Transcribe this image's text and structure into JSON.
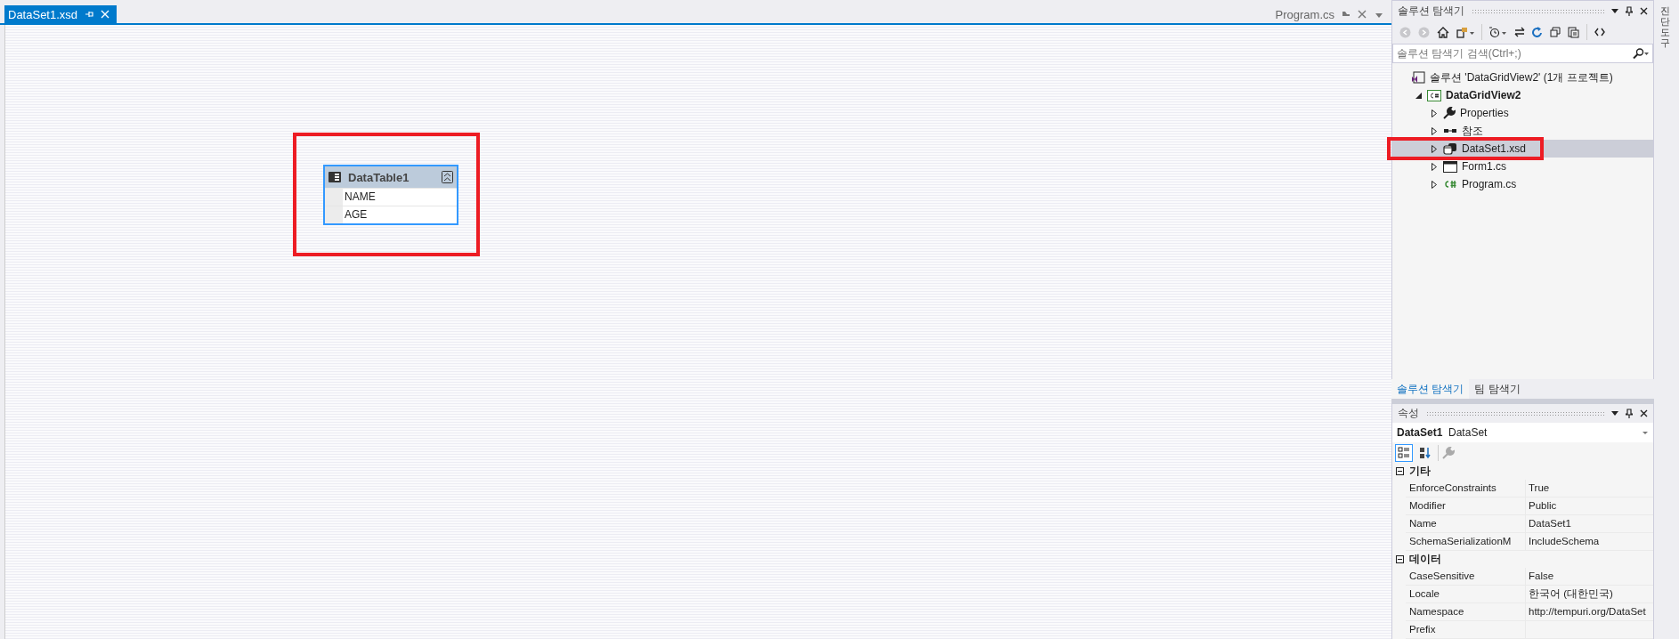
{
  "editor": {
    "tabs": [
      {
        "label": "DataSet1.xsd",
        "kind": "document",
        "selected": true
      },
      {
        "label": "Program.cs",
        "kind": "preview",
        "selected": false
      }
    ],
    "designer": {
      "table": {
        "title": "DataTable1",
        "columns": [
          "NAME",
          "AGE"
        ]
      }
    }
  },
  "solution_explorer": {
    "title": "솔루션 탐색기",
    "search": {
      "placeholder": "솔루션 탐색기 검색(Ctrl+;)"
    },
    "tree": [
      {
        "label": "솔루션 'DataGridView2' (1개 프로젝트)",
        "kind": "solution",
        "selected": false,
        "children": [
          {
            "label": "DataGridView2",
            "kind": "project",
            "expanded": true,
            "selected": false,
            "children": [
              {
                "label": "Properties",
                "kind": "properties",
                "expanded": false,
                "selected": false
              },
              {
                "label": "참조",
                "kind": "references",
                "expanded": false,
                "selected": false
              },
              {
                "label": "DataSet1.xsd",
                "kind": "dataset",
                "expanded": false,
                "selected": true
              },
              {
                "label": "Form1.cs",
                "kind": "form",
                "expanded": false,
                "selected": false
              },
              {
                "label": "Program.cs",
                "kind": "csfile",
                "expanded": false,
                "selected": false
              }
            ]
          }
        ]
      }
    ],
    "tabs": [
      {
        "label": "솔루션 탐색기",
        "selected": true
      },
      {
        "label": "팀 탐색기",
        "selected": false
      }
    ]
  },
  "properties": {
    "title": "속성",
    "object_name": "DataSet1",
    "object_type": "DataSet",
    "view_buttons": [
      {
        "kind": "categorized",
        "selected": true
      },
      {
        "kind": "alphabetical",
        "selected": false
      }
    ],
    "categories": [
      {
        "name": "기타",
        "expanded": true,
        "rows": [
          {
            "name": "EnforceConstraints",
            "value": "True"
          },
          {
            "name": "Modifier",
            "value": "Public"
          },
          {
            "name": "Name",
            "value": "DataSet1"
          },
          {
            "name": "SchemaSerializationM",
            "value": "IncludeSchema"
          }
        ]
      },
      {
        "name": "데이터",
        "expanded": true,
        "rows": [
          {
            "name": "CaseSensitive",
            "value": "False"
          },
          {
            "name": "Locale",
            "value": "한국어 (대한민국)"
          },
          {
            "name": "Namespace",
            "value": "http://tempuri.org/DataSet"
          },
          {
            "name": "Prefix"
          }
        ]
      }
    ]
  },
  "side_tab": {
    "label": "진단 도구"
  }
}
